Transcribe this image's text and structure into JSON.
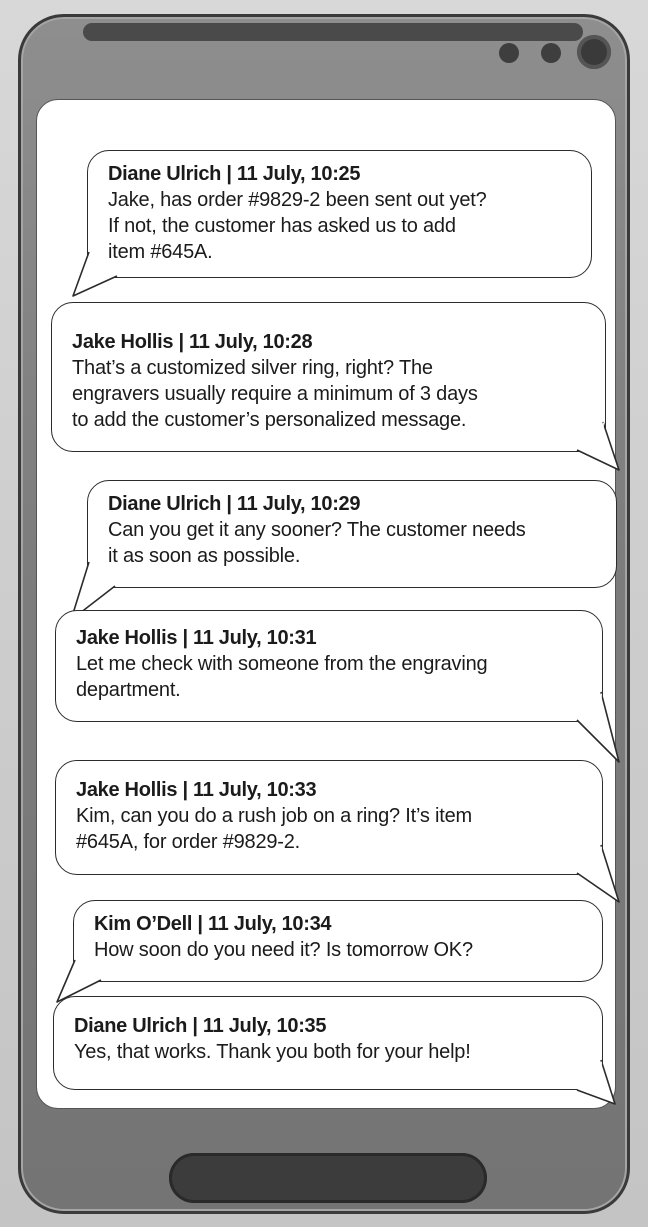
{
  "messages": [
    {
      "sender": "Diane Ulrich | 11 July, 10:25",
      "lines": [
        "Jake, has order #9829-2 been sent out yet?",
        "If not, the customer has asked us to add",
        "item #645A."
      ],
      "side": "left"
    },
    {
      "sender": "Jake Hollis | 11 July, 10:28",
      "lines": [
        "That’s a customized silver ring, right? The",
        "engravers usually require a minimum of 3 days",
        "to add the customer’s personalized message."
      ],
      "side": "right"
    },
    {
      "sender": "Diane Ulrich | 11 July, 10:29",
      "lines": [
        "Can you get it any sooner? The customer needs",
        "it as soon as possible."
      ],
      "side": "left"
    },
    {
      "sender": "Jake Hollis | 11 July, 10:31",
      "lines": [
        "Let me check with someone from the engraving",
        "department."
      ],
      "side": "right"
    },
    {
      "sender": "Jake Hollis | 11 July, 10:33",
      "lines": [
        "Kim, can you do a rush job on a ring? It’s item",
        "#645A, for order #9829-2."
      ],
      "side": "right"
    },
    {
      "sender": "Kim O’Dell  | 11 July, 10:34",
      "lines": [
        "How soon do you need it? Is tomorrow OK?"
      ],
      "side": "left"
    },
    {
      "sender": "Diane Ulrich | 11 July, 10:35",
      "lines": [
        "Yes, that works. Thank you both for your help!"
      ],
      "side": "right"
    }
  ]
}
